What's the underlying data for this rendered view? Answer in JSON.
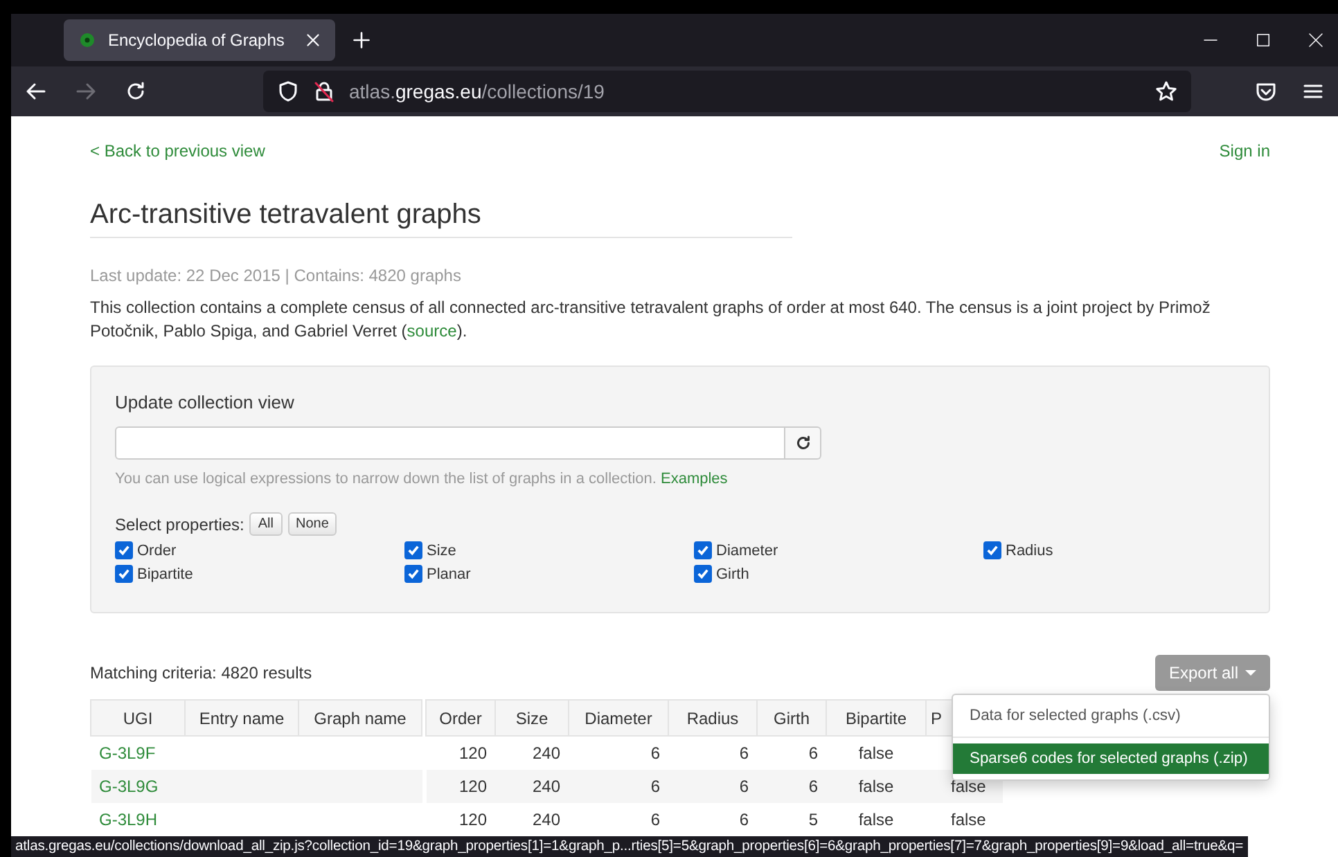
{
  "browser": {
    "tab": {
      "title": "Encyclopedia of Graphs",
      "selected": true
    },
    "url": {
      "prefix": "atlas.",
      "domain": "gregas.eu",
      "path": "/collections/19"
    },
    "forward_disabled": true
  },
  "page": {
    "back_link": "< Back to previous view",
    "sign_in": "Sign in",
    "title": "Arc-transitive tetravalent graphs",
    "meta": "Last update: 22 Dec 2015  | Contains: 4820 graphs",
    "description": "This collection contains a complete census of all connected arc-transitive tetravalent graphs of order at most 640. The census is a joint project by Primož Potočnik, Pablo Spiga, and Gabriel Verret (",
    "source_link": "source",
    "description_end": ")."
  },
  "filter": {
    "heading": "Update collection view",
    "hint": "You can use logical expressions to narrow down the list of graphs in a collection.",
    "examples_link": "Examples",
    "select_label": "Select properties:",
    "all_button": "All",
    "none_button": "None",
    "properties": [
      {
        "label": "Order",
        "checked": true
      },
      {
        "label": "Size",
        "checked": true
      },
      {
        "label": "Diameter",
        "checked": true
      },
      {
        "label": "Radius",
        "checked": true
      },
      {
        "label": "Bipartite",
        "checked": true
      },
      {
        "label": "Planar",
        "checked": true
      },
      {
        "label": "Girth",
        "checked": true
      }
    ]
  },
  "results": {
    "summary": "Matching criteria: 4820 results",
    "export_button": "Export all",
    "export_menu": [
      {
        "label": "Data for selected graphs (.csv)",
        "selected": false
      },
      {
        "label": "Sparse6 codes for selected graphs (.zip)",
        "selected": true
      }
    ],
    "name_columns": [
      "UGI",
      "Entry name",
      "Graph name"
    ],
    "value_columns": [
      {
        "label": "Order",
        "kind": "number"
      },
      {
        "label": "Size",
        "kind": "number"
      },
      {
        "label": "Diameter",
        "kind": "number"
      },
      {
        "label": "Radius",
        "kind": "number"
      },
      {
        "label": "Girth",
        "kind": "number"
      },
      {
        "label": "Bipartite",
        "kind": "boolean"
      },
      {
        "label": "P",
        "kind": "boolean"
      }
    ],
    "rows": [
      {
        "ugi": "G-3L9F",
        "cells": [
          "120",
          "240",
          "6",
          "6",
          "6",
          "false"
        ]
      },
      {
        "ugi": "G-3L9G",
        "cells": [
          "120",
          "240",
          "6",
          "6",
          "6",
          "false",
          "false"
        ]
      },
      {
        "ugi": "G-3L9H",
        "cells": [
          "120",
          "240",
          "6",
          "6",
          "5",
          "false",
          "false"
        ]
      }
    ]
  },
  "status_bar": "atlas.gregas.eu/collections/download_all_zip.js?collection_id=19&graph_properties[1]=1&graph_p...rties[5]=5&graph_properties[6]=6&graph_properties[7]=7&graph_properties[9]=9&load_all=true&q="
}
